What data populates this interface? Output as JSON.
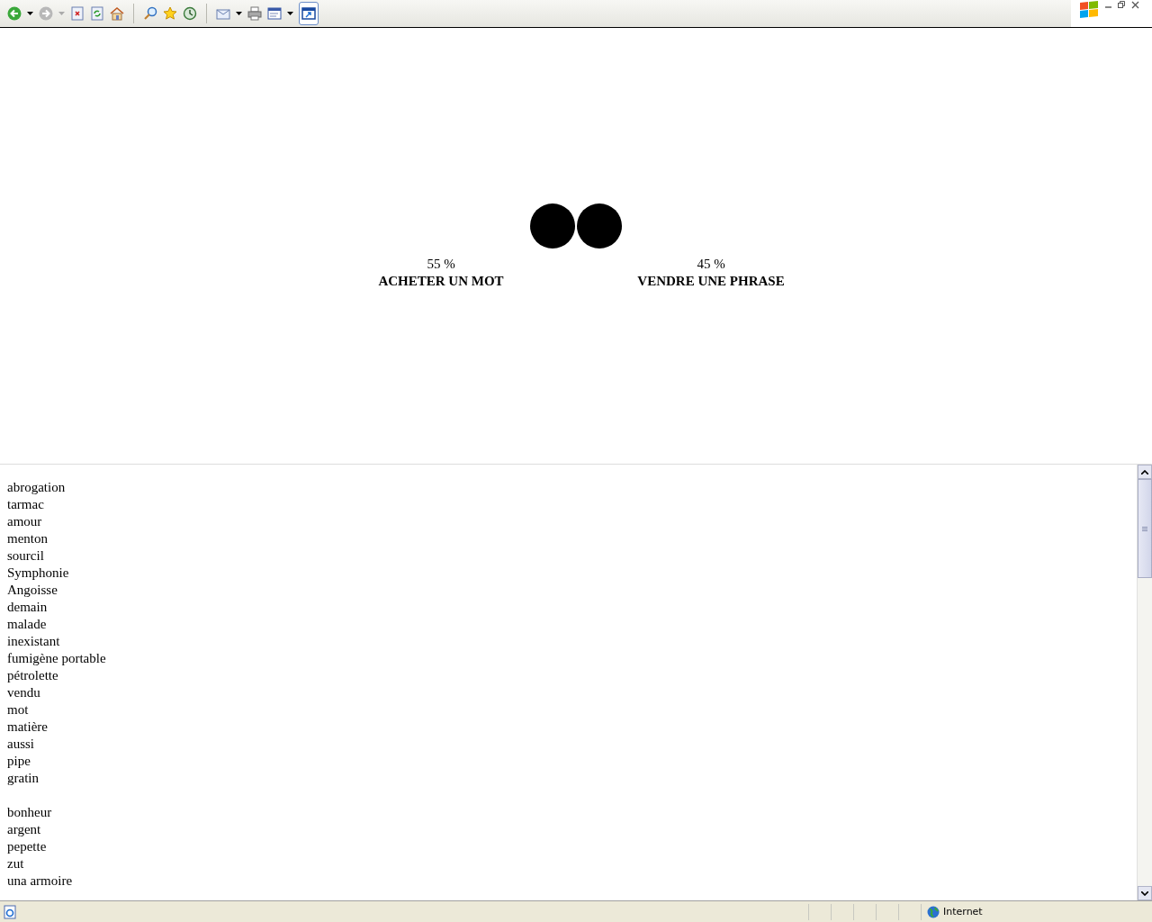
{
  "choices": [
    {
      "percent": "55 %",
      "label": "ACHETER UN MOT"
    },
    {
      "percent": "45 %",
      "label": "VENDRE UNE PHRASE"
    }
  ],
  "word_groups": [
    [
      "abrogation",
      "tarmac",
      "amour",
      "menton",
      "sourcil",
      "Symphonie",
      "Angoisse",
      "demain",
      "malade",
      "inexistant",
      "fumigène portable",
      "pétrolette",
      "vendu",
      "mot",
      "matière",
      "aussi",
      "pipe",
      "gratin"
    ],
    [
      "bonheur",
      "argent",
      "pepette",
      "zut",
      "una armoire"
    ]
  ],
  "status_bar": {
    "zone": "Internet"
  }
}
